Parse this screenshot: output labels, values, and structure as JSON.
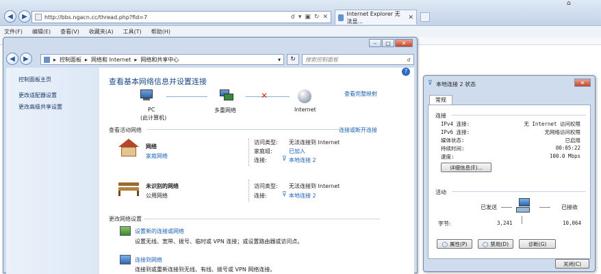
{
  "browser": {
    "url": "http://bbs.ngacn.cc/thread.php?fid=7",
    "tab_title": "Internet Explorer 无法显...",
    "menu": [
      "文件(F)",
      "编辑(E)",
      "查看(V)",
      "收藏夹(A)",
      "工具(T)",
      "帮助(H)"
    ]
  },
  "cp": {
    "breadcrumb": [
      "控制面板",
      "网络和 Internet",
      "网络和共享中心"
    ],
    "search_placeholder": "搜索控制面板",
    "sidebar": [
      "控制面板主页",
      "更改适配器设置",
      "更改高级共享设置"
    ],
    "heading": "查看基本网络信息并设置连接",
    "full_map": "查看完整映射",
    "map": {
      "pc": "PC",
      "pc_sub": "(此计算机)",
      "multi": "多重网络",
      "internet": "Internet"
    },
    "active_label": "查看活动网络",
    "connect_disconnect": "连接或断开连接",
    "networks": [
      {
        "name": "网络",
        "type": "家庭网络",
        "access_label": "访问类型:",
        "access": "无法连接到 Internet",
        "group_label": "家庭组:",
        "group": "已加入",
        "conn_label": "连接:",
        "conn": "本地连接 2"
      },
      {
        "name": "未识别的网络",
        "type": "公用网络",
        "access_label": "访问类型:",
        "access": "无法连接到 Internet",
        "conn_label": "连接:",
        "conn": "本地连接 2"
      }
    ],
    "change_label": "更改网络设置",
    "tasks": [
      {
        "title": "设置新的连接或网络",
        "desc": "设置无线、宽带、拨号、临时或 VPN 连接；或设置路由器或访问点。"
      },
      {
        "title": "连接到网络",
        "desc": "连接到或重新连接到无线、有线、拨号或 VPN 网络连接。"
      }
    ]
  },
  "status": {
    "title": "本地连接 2 状态",
    "tab": "常规",
    "conn_section": "连接",
    "rows": [
      {
        "k": "IPv4 连接:",
        "v": "无 Internet 访问权限"
      },
      {
        "k": "IPv6 连接:",
        "v": "无网络访问权限"
      },
      {
        "k": "媒体状态:",
        "v": "已启用"
      },
      {
        "k": "持续时间:",
        "v": "00:05:22"
      },
      {
        "k": "速度:",
        "v": "100.0 Mbps"
      }
    ],
    "details_btn": "详细信息(E)...",
    "activity": "活动",
    "sent": "已发送",
    "received": "已接收",
    "bytes_label": "字节:",
    "bytes_sent": "3,241",
    "bytes_recv": "10,064",
    "props_btn": "属性(P)",
    "disable_btn": "禁用(D)",
    "diagnose_btn": "诊断(G)",
    "close_btn": "关闭(C)"
  }
}
